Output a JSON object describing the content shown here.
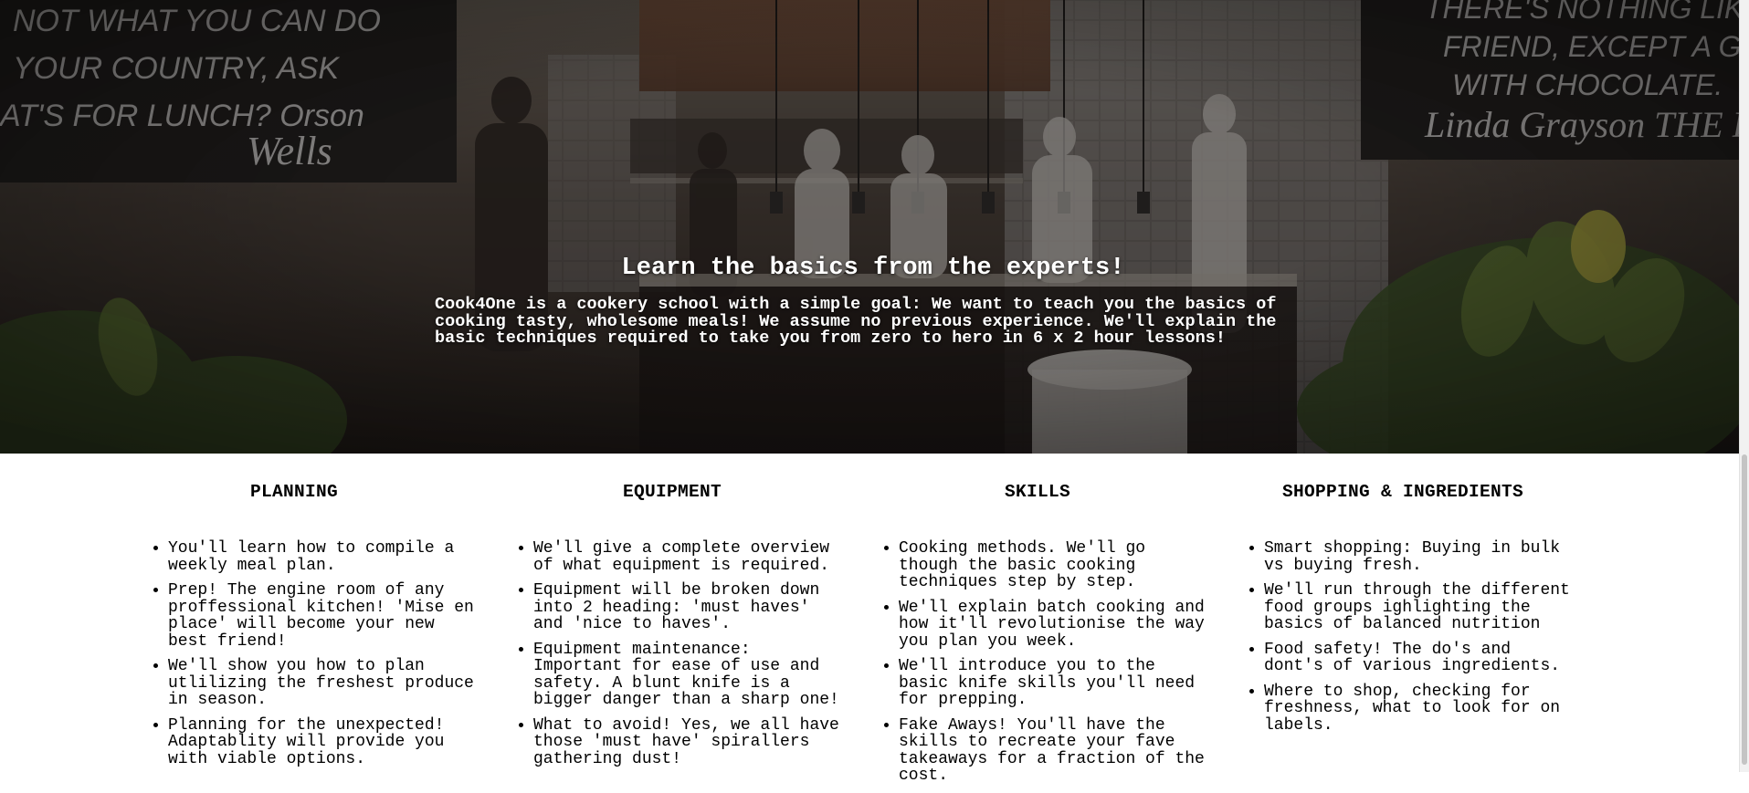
{
  "hero": {
    "title": "Learn the basics from the experts!",
    "text": "Cook4One is a cookery school with a simple goal: We want to teach you the basics of cooking tasty, wholesome meals! We assume no previous experience. We'll explain the basic techniques required to take you from zero to hero in 6 x 2 hour lessons!",
    "image_description": "professional-kitchen-photo",
    "chalkboard_left": "NOT WHAT YOU CAN DO YOUR COUNTRY, ASK AT'S FOR LUNCH? Orson Wells",
    "chalkboard_right": "THERE'S NOTHING LIKE FRIEND, EXCEPT A GO WITH CHOCOLATE. Linda Grayson THE P"
  },
  "columns": [
    {
      "heading": "PLANNING",
      "items": [
        "You'll learn how to compile a weekly meal plan.",
        "Prep! The engine room of any proffessional kitchen! 'Mise en place' will become your new best friend!",
        "We'll show you how to plan utlilizing the freshest produce in season.",
        "Planning for the unexpected! Adaptablity will provide you with viable options."
      ]
    },
    {
      "heading": "EQUIPMENT",
      "items": [
        "We'll give a complete overview of what equipment is required.",
        "Equipment will be broken down into 2 heading: 'must haves' and 'nice to haves'.",
        "Equipment maintenance: Important for ease of use and safety. A blunt knife is a bigger danger than a sharp one!",
        "What to avoid! Yes, we all have those 'must have' spirallers gathering dust!"
      ]
    },
    {
      "heading": "SKILLS",
      "items": [
        "Cooking methods. We'll go though the basic cooking techniques step by step.",
        "We'll explain batch cooking and how it'll revolutionise the way you plan you week.",
        "We'll introduce you to the basic knife skills you'll need for prepping.",
        "Fake Aways! You'll have the skills to recreate your fave takeaways for a fraction of the cost."
      ]
    },
    {
      "heading": "SHOPPING & INGREDIENTS",
      "items": [
        "Smart shopping: Buying in bulk vs buying fresh.",
        "We'll run through the different food groups ighlighting the basics of balanced nutrition",
        "Food safety! The do's and dont's of various ingredients.",
        "Where to shop, checking for freshness, what to look for on labels."
      ]
    }
  ],
  "colors": {
    "hero_overlay": "#1f1b19",
    "chalkboard": "#1d1d1d",
    "text": "#000000",
    "hero_text": "#ffffff"
  }
}
